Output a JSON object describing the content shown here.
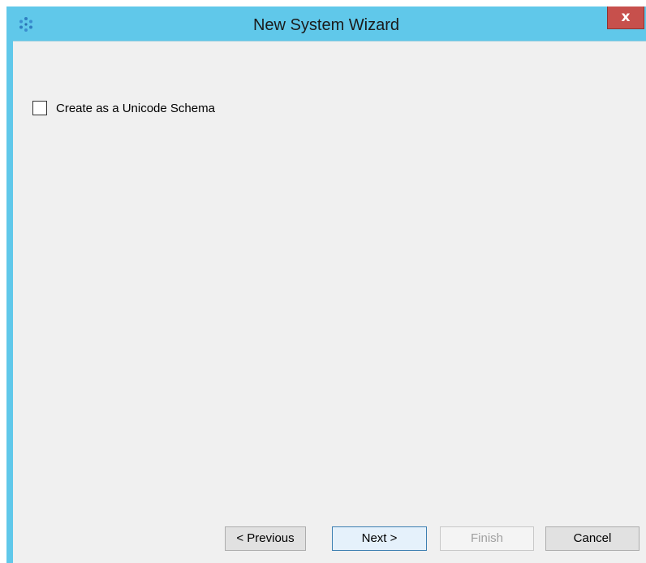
{
  "window": {
    "title": "New System Wizard",
    "close_label": "x",
    "icon": "wizard-app-icon"
  },
  "options": {
    "unicode_schema": {
      "label": "Create as a Unicode Schema",
      "checked": false
    }
  },
  "buttons": {
    "previous": "< Previous",
    "next": "Next >",
    "finish": "Finish",
    "cancel": "Cancel"
  },
  "colors": {
    "titlebar": "#60c8ea",
    "close_button": "#c7504c",
    "client_background": "#f0f0f0"
  }
}
